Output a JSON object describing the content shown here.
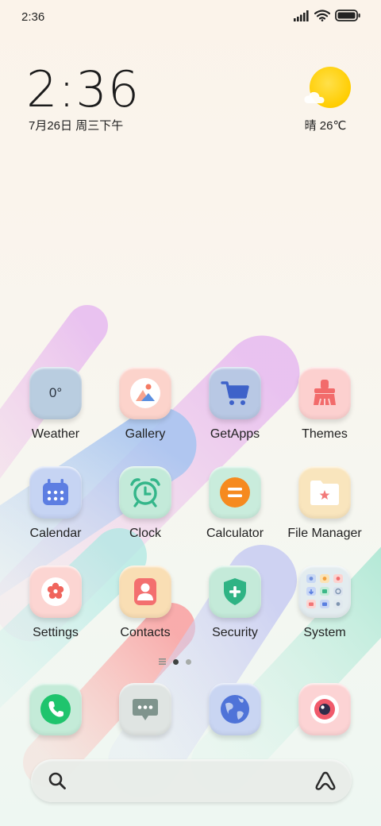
{
  "status_bar": {
    "time": "2:36"
  },
  "clock_widget": {
    "time": "2:36",
    "date": "7月26日 周三下午"
  },
  "weather_widget": {
    "text": "晴 26℃"
  },
  "apps": [
    {
      "label": "Weather",
      "icon": "weather-icon",
      "tile_text": "0°",
      "color": "#b9cde0"
    },
    {
      "label": "Gallery",
      "icon": "gallery-icon",
      "color": "#fcd3cb"
    },
    {
      "label": "GetApps",
      "icon": "shopping-cart-icon",
      "color": "#b8c8e4"
    },
    {
      "label": "Themes",
      "icon": "paintbrush-icon",
      "color": "#fcd0cf"
    },
    {
      "label": "Calendar",
      "icon": "calendar-icon",
      "color": "#c6d4f3"
    },
    {
      "label": "Clock",
      "icon": "alarm-clock-icon",
      "color": "#c3ead9"
    },
    {
      "label": "Calculator",
      "icon": "calculator-icon",
      "color": "#c9ecdc"
    },
    {
      "label": "File Manager",
      "icon": "folder-icon",
      "color": "#f9e5bd"
    },
    {
      "label": "Settings",
      "icon": "gear-icon",
      "color": "#fcd5d2"
    },
    {
      "label": "Contacts",
      "icon": "contacts-icon",
      "color": "#f9deb4"
    },
    {
      "label": "Security",
      "icon": "shield-icon",
      "color": "#c4ead9"
    },
    {
      "label": "System",
      "icon": "folder-grid-icon",
      "color": "#e3ecef"
    }
  ],
  "dock": [
    {
      "name": "phone",
      "icon": "phone-icon",
      "color": "#c4ebd8"
    },
    {
      "name": "messages",
      "icon": "message-icon",
      "color": "#dfe4e2"
    },
    {
      "name": "browser",
      "icon": "globe-icon",
      "color": "#c9d5f2"
    },
    {
      "name": "camera",
      "icon": "camera-icon",
      "color": "#fcd3d4"
    }
  ],
  "page_indicator": {
    "pages": 2,
    "current": 1
  },
  "colors": {
    "accent_green": "#29c77b",
    "accent_blue": "#5a86e0",
    "accent_coral": "#f36e6e",
    "sun": "#ffcd00"
  }
}
